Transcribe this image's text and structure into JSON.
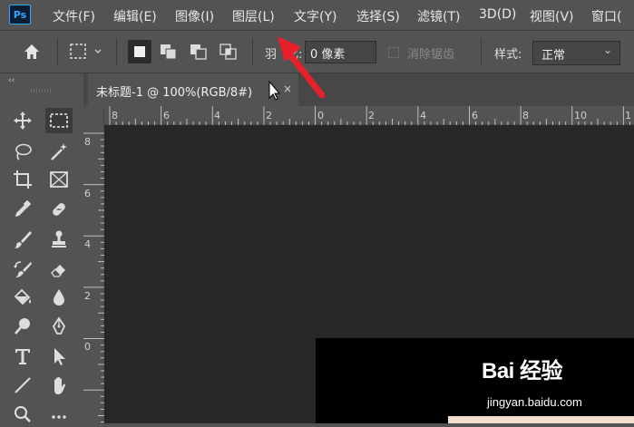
{
  "app": {
    "logo": "Ps"
  },
  "menu": [
    "文件(F)",
    "编辑(E)",
    "图像(I)",
    "图层(L)",
    "文字(Y)",
    "选择(S)",
    "滤镜(T)",
    "3D(D)",
    "视图(V)",
    "窗口("
  ],
  "options": {
    "feather_label": "羽",
    "feather_colon": "化:",
    "feather_value": "0 像素",
    "antialias_label": "消除锯齿",
    "style_label": "样式:",
    "style_value": "正常"
  },
  "toolbar": {
    "collapse": "‹‹"
  },
  "document": {
    "tab_title": "未标题-1 @ 100%(RGB/8#)",
    "close": "×"
  },
  "ruler_h_labels": [
    "8",
    "6",
    "4",
    "2",
    "0",
    "2",
    "4",
    "6",
    "8",
    "10",
    "1"
  ],
  "ruler_v_labels": [
    "8",
    "6",
    "4",
    "2",
    "0"
  ],
  "watermark": {
    "logo": "Bai 经验",
    "url": "jingyan.baidu.com"
  },
  "colors": {
    "app_bg": "#535353",
    "canvas_bg": "#282828",
    "accent": "#31a8ff",
    "arrow": "#e8202a"
  }
}
